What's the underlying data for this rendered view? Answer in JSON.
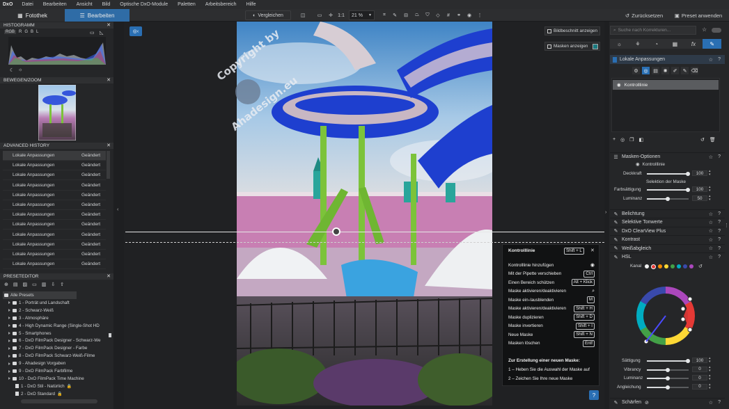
{
  "menubar": {
    "logo": "DxO",
    "items": [
      "Datei",
      "Bearbeiten",
      "Ansicht",
      "Bild",
      "Optische DxO-Module",
      "Paletten",
      "Arbeitsbereich",
      "Hilfe"
    ]
  },
  "toolbar": {
    "tab_fotothek": "Fotothek",
    "tab_bearbeiten": "Bearbeiten",
    "compare_label": "Vergleichen",
    "zoom_1to1": "1:1",
    "zoom_value": "21 %",
    "reset_label": "Zurücksetzen",
    "preset_apply": "Preset anwenden"
  },
  "histogram": {
    "title": "HISTOGRAMM",
    "channels": [
      "RGB",
      "R",
      "G",
      "B",
      "L"
    ]
  },
  "navigator": {
    "title": "BEWEGEN/ZOOM"
  },
  "history": {
    "title": "ADVANCED HISTORY",
    "rows": [
      {
        "action": "Lokale Anpassungen",
        "state": "Geändert"
      },
      {
        "action": "Lokale Anpassungen",
        "state": "Geändert"
      },
      {
        "action": "Lokale Anpassungen",
        "state": "Geändert"
      },
      {
        "action": "Lokale Anpassungen",
        "state": "Geändert"
      },
      {
        "action": "Lokale Anpassungen",
        "state": "Geändert"
      },
      {
        "action": "Lokale Anpassungen",
        "state": "Geändert"
      },
      {
        "action": "Lokale Anpassungen",
        "state": "Geändert"
      },
      {
        "action": "Lokale Anpassungen",
        "state": "Geändert"
      },
      {
        "action": "Lokale Anpassungen",
        "state": "Geändert"
      },
      {
        "action": "Lokale Anpassungen",
        "state": "Geändert"
      },
      {
        "action": "Lokale Anpassungen",
        "state": "Geändert"
      },
      {
        "action": "Lokale Anpassungen",
        "state": "Geändert"
      }
    ]
  },
  "presets": {
    "title": "PRESETEDITOR",
    "items": [
      "Alle Presets",
      "1 - Porträt und Landschaft",
      "2 - Schwarz-Weiß",
      "3 - Atmosphäre",
      "4 - High Dynamic Range (Single-Shot HD",
      "5 - Smartphones",
      "6 - DxO FilmPack Designer - Schwarz-We",
      "7 - DxO FilmPack Designer - Farbe",
      "8 - DxO FilmPack Schwarz-Weiß-Filme",
      "9 - Ahadesign Vorgaben",
      "9 - DxO FilmPack Farbfilme",
      "10 - DxO FilmPack Time Machine",
      "1 - DxO Stil - Natürlich",
      "2 - DxO Standard"
    ]
  },
  "viewer": {
    "crop_toggle": "Bildbeschnitt anzeigen",
    "mask_toggle": "Masken anzeigen",
    "watermark_top": "Copyright by",
    "watermark_bottom": "Ahadesign.eu"
  },
  "popup": {
    "title": "Kontrolllinie",
    "title_shortcut": "Shift + L",
    "rows": [
      {
        "label": "Kontrolllinie hinzufügen",
        "key": ""
      },
      {
        "label": "Mit der Pipette verschieben",
        "key": "Ctrl"
      },
      {
        "label": "Einen Bereich schützen",
        "key": "Alt + Klick"
      },
      {
        "label": "Maske aktivieren/deaktivieren",
        "key": ""
      },
      {
        "label": "Maske ein-/ausblenden",
        "key": "M"
      },
      {
        "label": "Maske aktivieren/deaktivieren",
        "key": "Shift + H"
      },
      {
        "label": "Maske duplizieren",
        "key": "Shift + D"
      },
      {
        "label": "Maske invertieren",
        "key": "Shift + I"
      },
      {
        "label": "Neue Maske",
        "key": "Shift + N"
      },
      {
        "label": "Masken löschen",
        "key": "Entf"
      }
    ],
    "help_title": "Zur Erstellung einer neuen Maske:",
    "help_step1": "1 – Heben Sie die Auswahl der Maske auf",
    "help_step2": "2 – Zeichen Sie Ihre neue Maske"
  },
  "right": {
    "search_placeholder": "Suche nach Korrekturen...",
    "local_adjust_title": "Lokale Anpassungen",
    "mask_item": "Kontrolllinie",
    "mask_options": "Masken-Optionen",
    "control_line": "Kontrolllinie",
    "opacity_label": "Deckkraft",
    "opacity_value": "100",
    "selection_label": "Selektion der Maske",
    "saturation_sel_label": "Farbsättigung",
    "saturation_sel_value": "100",
    "luminance_sel_label": "Luminanz",
    "luminance_sel_value": "50",
    "sections": [
      "Belichtung",
      "Selektive Tonwerte",
      "DxO ClearView Plus",
      "Kontrast",
      "Weißabgleich",
      "HSL"
    ],
    "channel_label": "Kanal",
    "hsl_sliders": [
      {
        "label": "Sättigung",
        "value": "100"
      },
      {
        "label": "Vibrancy",
        "value": "0"
      },
      {
        "label": "Luminanz",
        "value": "0"
      },
      {
        "label": "Angleichung",
        "value": "0"
      }
    ],
    "bottom_section": "Schärfen"
  },
  "colors": {
    "accent": "#2a6fb3",
    "tab_active": "#2f6ca6",
    "panel": "#252628"
  }
}
